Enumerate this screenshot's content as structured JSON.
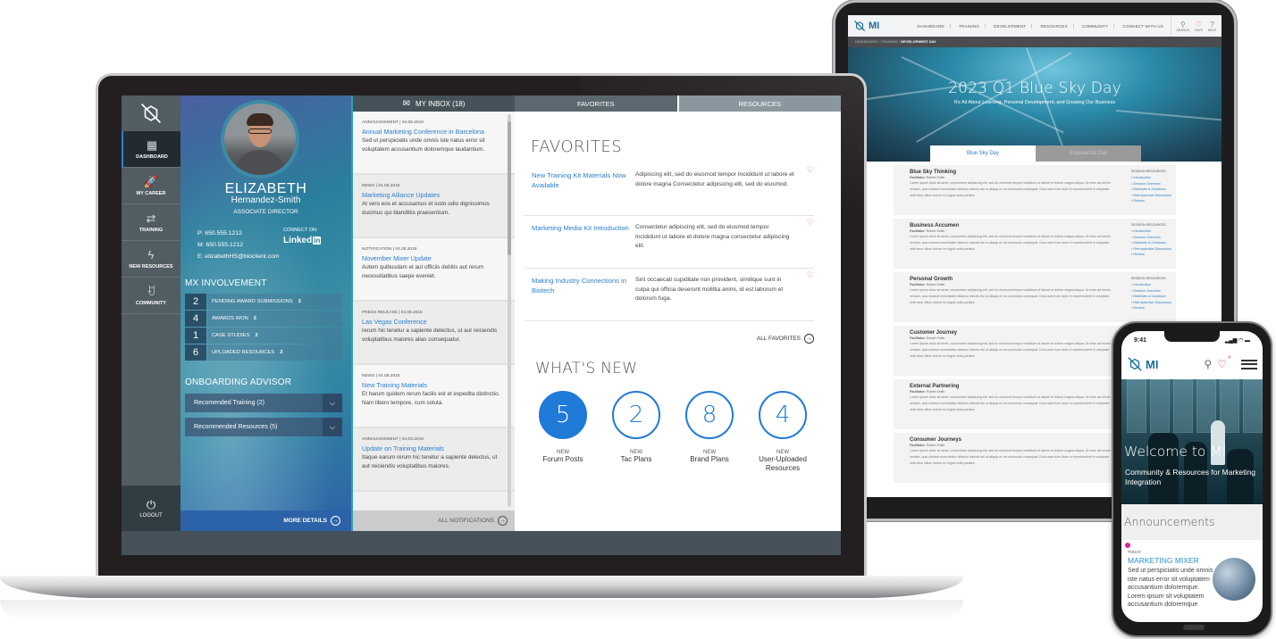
{
  "tablet": {
    "logo_text": "MI",
    "nav": [
      "DASHBOARD",
      "TRAINING",
      "DEVELOPMENT",
      "RESOURCES",
      "COMMUNITY",
      "CONNECT WITH US"
    ],
    "icons": [
      {
        "icon": "search-icon",
        "label": "SEARCH"
      },
      {
        "icon": "heart-icon",
        "label": "FAVS"
      },
      {
        "icon": "help-icon",
        "label": "HELP"
      }
    ],
    "breadcrumb": {
      "items": [
        "DASHBOARD",
        "TRAINING"
      ],
      "current": "DEVELOPMENT DAY",
      "separator": "/"
    },
    "hero_title": "2023 Q1 Blue Sky Day",
    "hero_subtitle": "It's All About Learning, Personal Development, and Growing Our Business",
    "tabs": [
      "Blue Sky Day",
      "Experience Day"
    ],
    "facilitator_label": "Facilitator:",
    "facilitator": "Robert Smith",
    "session_body": "Lorem ipsum dolor sit amet, consectetur adipiscing elit, sed do eiusmod tempor incididunt ut labore et dolore magna aliqua. Ut enim ad minim veniam, quis nostrud exercitation ullamco laboris nisi ut aliquip ex ea commodo consequat. Duis aute irure dolor in reprehenderit in voluptate velit esse cillum dolore eu fugiat nulla pariatur.",
    "resources_header": "SESSION RESOURCES",
    "resource_links": [
      "Introduction",
      "Session Overview",
      "Materials & Guidance",
      "Retrospective Discussion",
      "Review"
    ],
    "sessions": [
      "Blue Sky Thinking",
      "Business Accumen",
      "Personal Growth",
      "Customer Journey",
      "External Partnering",
      "Consumer Journeys"
    ]
  },
  "laptop": {
    "nav": {
      "items": [
        {
          "label": "DASHBOARD",
          "icon": "dashboard-grid-icon",
          "glyph": "▦",
          "active": true
        },
        {
          "label": "MY CAREER",
          "icon": "rocket-icon",
          "glyph": "🚀",
          "active": false
        },
        {
          "label": "TRAINING",
          "icon": "cycle-arrows-icon",
          "glyph": "⇄",
          "active": false
        },
        {
          "label": "NEW RESOURCES",
          "icon": "lightning-icon",
          "glyph": "ϟ",
          "active": false
        },
        {
          "label": "COMMUNITY",
          "icon": "people-icon",
          "glyph": "ꀀ",
          "active": false
        }
      ],
      "logout_label": "LOGOUT"
    },
    "profile": {
      "first_name": "ELIZABETH",
      "last_name": "Hernandez-Smith",
      "title": "ASSOCIATE DIRECTOR",
      "phone": "P: 650.555.1212",
      "mobile": "M: 650.555.1212",
      "email": "E: elizabethHS@bioclient.com",
      "connect_label": "CONNECT ON:",
      "linkedin_text": "Linked",
      "linkedin_in": "in",
      "mx_header": "MX INVOLVEMENT",
      "mx_rows": [
        {
          "num": "2",
          "label": "PENDING AWARD SUBMISSIONS",
          "count": "2"
        },
        {
          "num": "4",
          "label": "AWARDS WON",
          "count": "2"
        },
        {
          "num": "1",
          "label": "CASE STUDIES",
          "count": "2"
        },
        {
          "num": "6",
          "label": "UPLOADED RESOURCES",
          "count": "2"
        }
      ],
      "advisor_header": "ONBOARDING ADVISOR",
      "advisor_items": [
        "Recomended Training (2)",
        "Recommended Resources (5)"
      ],
      "more_details": "MORE DETAILS"
    },
    "inbox": {
      "header": "MY INBOX (18)",
      "messages": [
        {
          "type": "ANNOUNCEMENT",
          "date": "04.08.2018",
          "title": "Annual Marketing Conference in Barcelona",
          "body": "Sed ut perspiciatis unde omnis iste natus error sit voluptatem accusantium doloremque laudantium."
        },
        {
          "type": "NEWS",
          "date": "04.08.2018",
          "title": "Marketing Alliance Updates",
          "body": "At vero eos et accusamus et iusto odio dignissimos ducimus qui blanditiis praesentium."
        },
        {
          "type": "NOTIFICATION",
          "date": "04.08.2018",
          "title": "November Mixer Update",
          "body": "Autem quibusdam et aut officiis debitis aut rerum necessitatibus saepe eveniet."
        },
        {
          "type": "PRESS RELEASE",
          "date": "04.08.2018",
          "title": "Las Vegas Conference",
          "body": "rerum hic tenetur a sapiente delectus, ut aut reiciendis voluptatibus maiores alias consequatur."
        },
        {
          "type": "NEWS",
          "date": "04.08.2018",
          "title": "New Training Materials",
          "body": "Et harum quidem rerum facilis est et expedita distinctio. Nam libero tempore, cum soluta."
        },
        {
          "type": "ANNOUNCEMENT",
          "date": "04.08.2018",
          "title": "Update on Training Materials",
          "body": "Itaque earum rerum hic tenetur a sapiente delectus, ut aut reiciendis voluptatibus maiores."
        }
      ],
      "all_notifications": "ALL NOTIFICATIONS"
    },
    "tabs": [
      "FAVORITES",
      "RESOURCES"
    ],
    "favorites": {
      "header": "FAVORITES",
      "items": [
        {
          "title": "New Training Kit Materials Now Available",
          "desc": "Adipiscing elit, sed do eiusmod tempor Incididunt ut labore et dolore magna  Consectetur adipiscing elit, sed do eiusmod."
        },
        {
          "title": "Marketing Media Kit Introduction",
          "desc": "Consectetur adipiscing elit, sed do eiusmod tempor Incididunt ut labore et dolore magna consectetur adipiscing elit."
        },
        {
          "title": "Making Industry Connections in Biotech",
          "desc": "Sint occaecati cupiditate non provident, similique sunt in culpa qui officia deserunt mollitia animi, id est laborum et dolorum fuga."
        }
      ],
      "all_label": "ALL FAVORITES"
    },
    "whats_new": {
      "header": "WHAT'S NEW",
      "new_label": "NEW",
      "items": [
        {
          "count": "5",
          "label": "Forum Posts"
        },
        {
          "count": "2",
          "label": "Tac Plans"
        },
        {
          "count": "8",
          "label": "Brand Plans"
        },
        {
          "count": "4",
          "label": "User-Uploaded Resources"
        }
      ]
    }
  },
  "phone": {
    "time": "9:41",
    "logo_text": "MI",
    "fav_count": "4",
    "hero_title": "Welcome to MI",
    "hero_subtitle": "Community & Resources for Marketing Integration",
    "section_header": "Announcements",
    "card": {
      "when": "TODAY",
      "title": "MARKETING MIXER",
      "body": "Sed ut perspiciatis unde omnis iste natus error sit voluptatem accusantium doloremque. Lorem ipsum sit voluptatem accusantium doloremque"
    }
  },
  "colors": {
    "accent_blue": "#1f7ad8",
    "heart_pink": "#d9368a",
    "brand_teal": "#1a6f9a"
  }
}
